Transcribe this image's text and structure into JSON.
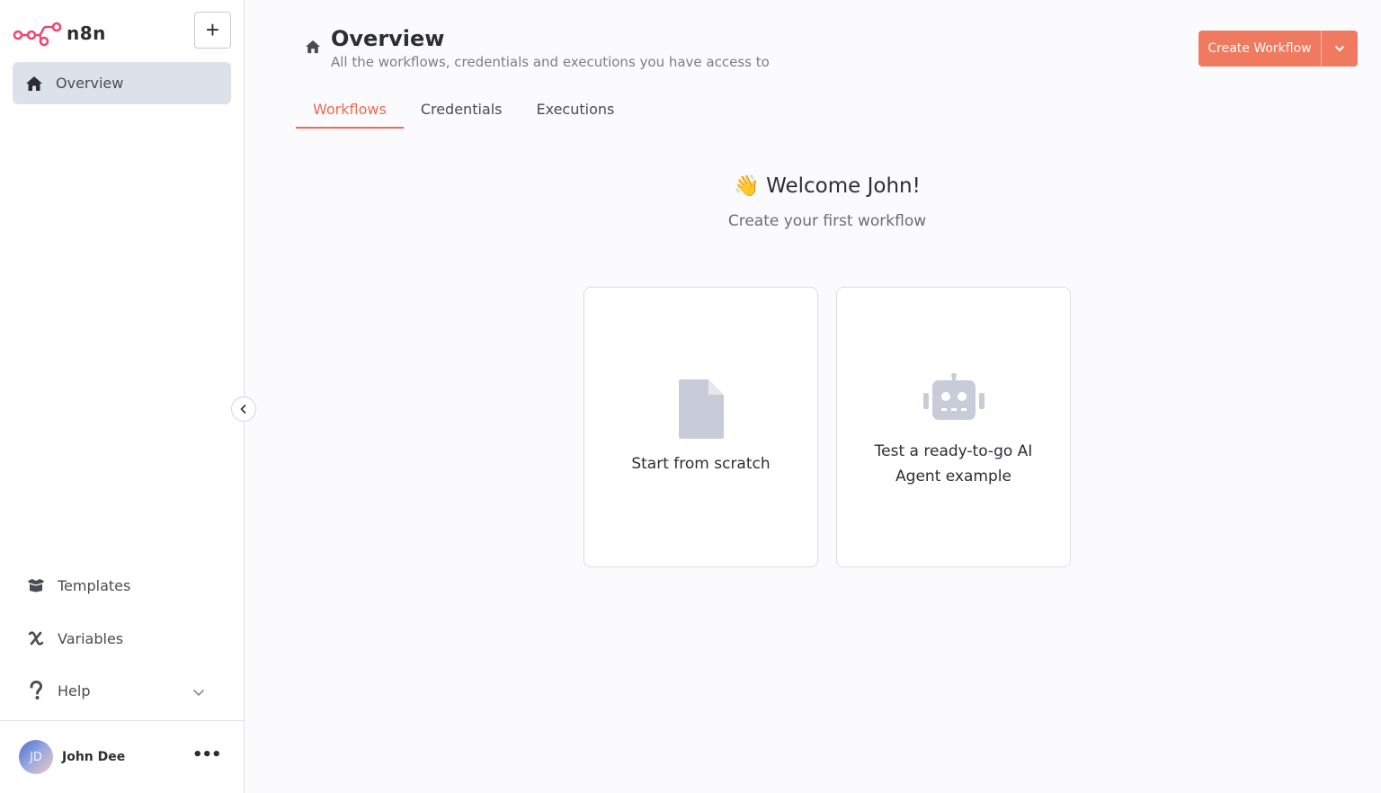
{
  "app": {
    "name": "n8n"
  },
  "sidebar": {
    "add_label": "+",
    "overview_label": "Overview",
    "templates_label": "Templates",
    "variables_label": "Variables",
    "help_label": "Help",
    "user": {
      "initials": "JD",
      "name": "John Dee",
      "menu": "•••"
    }
  },
  "header": {
    "title": "Overview",
    "subtitle": "All the workflows, credentials and executions you have access to",
    "create_label": "Create Workflow"
  },
  "tabs": [
    {
      "label": "Workflows",
      "active": true
    },
    {
      "label": "Credentials",
      "active": false
    },
    {
      "label": "Executions",
      "active": false
    }
  ],
  "welcome": {
    "emoji": "👋",
    "title": "Welcome John!",
    "subtitle": "Create your first workflow"
  },
  "cards": [
    {
      "label": "Start from scratch",
      "icon": "file-icon"
    },
    {
      "label": "Test a ready-to-go AI Agent example",
      "icon": "robot-icon"
    }
  ],
  "colors": {
    "accent": "#ef7a5f",
    "accent_text": "#ef6b4d",
    "active_nav_bg": "#dde1e9",
    "logo": "#ea4b71",
    "icon_gray": "#c8ccd8"
  }
}
